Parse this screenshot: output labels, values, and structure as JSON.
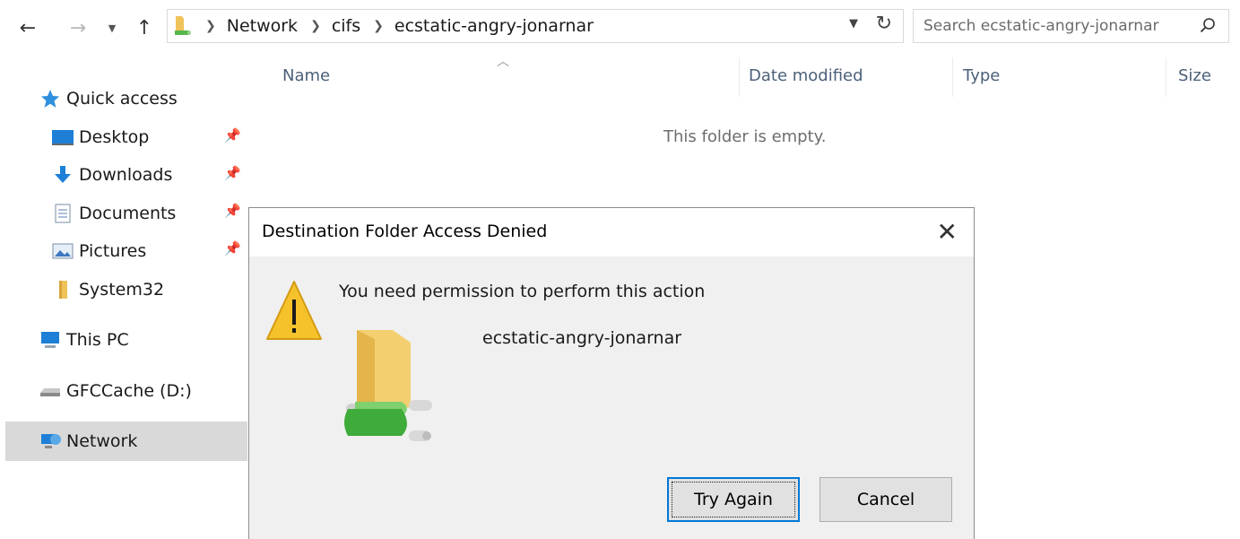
{
  "toolbar": {
    "back_icon": "arrow-left-icon",
    "forward_icon": "arrow-right-icon",
    "recent_icon": "chevron-down-icon",
    "up_icon": "arrow-up-icon"
  },
  "address": {
    "breadcrumbs": [
      "Network",
      "cifs",
      "ecstatic-angry-jonarnar"
    ]
  },
  "search": {
    "placeholder": "Search ecstatic-angry-jonarnar"
  },
  "columns": {
    "name": "Name",
    "date_modified": "Date modified",
    "type": "Type",
    "size": "Size"
  },
  "content": {
    "empty_message": "This folder is empty."
  },
  "sidebar": {
    "items": [
      {
        "label": "Quick access",
        "icon": "star-icon"
      },
      {
        "label": "Desktop",
        "icon": "desktop-icon",
        "pinned": true
      },
      {
        "label": "Downloads",
        "icon": "download-icon",
        "pinned": true
      },
      {
        "label": "Documents",
        "icon": "documents-icon",
        "pinned": true
      },
      {
        "label": "Pictures",
        "icon": "pictures-icon",
        "pinned": true
      },
      {
        "label": "System32",
        "icon": "folder-icon"
      },
      {
        "label": "This PC",
        "icon": "computer-icon"
      },
      {
        "label": "GFCCache (D:)",
        "icon": "drive-icon"
      },
      {
        "label": "Network",
        "icon": "network-icon",
        "selected": true
      }
    ]
  },
  "dialog": {
    "title": "Destination Folder Access Denied",
    "message": "You need permission to perform this action",
    "folder_name": "ecstatic-angry-jonarnar",
    "try_again_label": "Try Again",
    "cancel_label": "Cancel",
    "close_glyph": "✕"
  },
  "colors": {
    "accent": "#0078d7",
    "selected_bg": "#d9d9d9",
    "dialog_bg": "#f0f0f0",
    "warning": "#f5c22b"
  }
}
